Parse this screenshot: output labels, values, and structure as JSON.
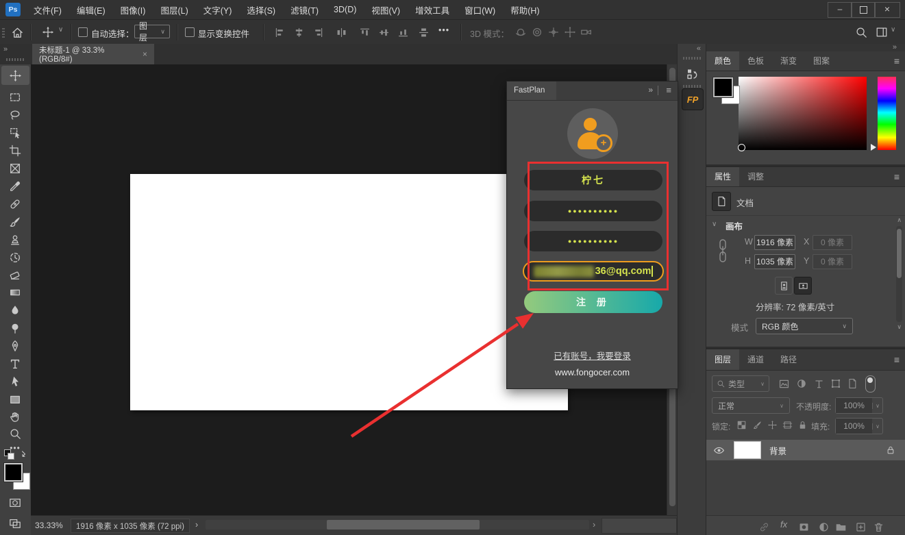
{
  "colors": {
    "accent_orange": "#f09d1f",
    "form_text_green": "#d6e44e",
    "register_gradient_start": "#94ca7d",
    "register_gradient_end": "#17a9aa",
    "annotation_red": "#e93030"
  },
  "icons": {
    "app_logo": "Ps",
    "collapse_right": "»",
    "collapse_left": "«",
    "panel_menu": "≡",
    "close": "×",
    "chevron_down": "∨",
    "chevron_up": "∧",
    "chevron_right": "›",
    "chevron_left": "‹",
    "ellipsis": "•••",
    "fx": "fx",
    "fp_badge": "FP",
    "minimize": "–"
  },
  "menu": {
    "items": [
      "文件(F)",
      "编辑(E)",
      "图像(I)",
      "图层(L)",
      "文字(Y)",
      "选择(S)",
      "滤镜(T)",
      "3D(D)",
      "视图(V)",
      "增效工具",
      "窗口(W)",
      "帮助(H)"
    ]
  },
  "options_bar": {
    "auto_select_label": "自动选择：",
    "auto_select_value": "图层",
    "show_transform_label": "显示变换控件",
    "mode_3d_label": "3D 模式："
  },
  "document": {
    "tab_title": "未标题-1 @ 33.3%(RGB/8#)"
  },
  "toolbar": {
    "tools": [
      "move",
      "rectangular-marquee",
      "lasso",
      "object-selection",
      "crop",
      "frame",
      "eyedropper",
      "spot-healing-brush",
      "brush",
      "clone-stamp",
      "history-brush",
      "eraser",
      "gradient",
      "blur",
      "dodge",
      "pen",
      "type",
      "path-selection",
      "rectangle",
      "hand",
      "zoom",
      "edit-toolbar"
    ]
  },
  "fastplan": {
    "tab_title": "FastPlan",
    "username": "柠七",
    "password_mask": "●●●●●●●●●●",
    "confirm_password_mask": "●●●●●●●●●●",
    "email_visible": "36@qq.com",
    "register_label": "注 册",
    "login_link": "已有账号，我要登录",
    "website": "www.fongocer.com"
  },
  "color_panel": {
    "tabs": [
      "颜色",
      "色板",
      "渐变",
      "图案"
    ]
  },
  "properties_panel": {
    "tabs": [
      "属性",
      "调整"
    ],
    "document_label": "文档",
    "section_canvas": "画布",
    "w_label": "W",
    "w_value": "1916 像素",
    "x_label": "X",
    "x_value": "0 像素",
    "h_label": "H",
    "h_value": "1035 像素",
    "y_label": "Y",
    "y_value": "0 像素",
    "resolution_text": "分辨率: 72 像素/英寸",
    "mode_label": "模式",
    "mode_value": "RGB 颜色"
  },
  "layers_panel": {
    "tabs": [
      "图层",
      "通道",
      "路径"
    ],
    "filter_label": "类型",
    "blend_mode": "正常",
    "opacity_label": "不透明度:",
    "opacity_value": "100%",
    "lock_label": "锁定:",
    "fill_label": "填充:",
    "fill_value": "100%",
    "layers": [
      {
        "name": "背景",
        "locked": true,
        "visible": true
      }
    ]
  },
  "status_bar": {
    "zoom_value": "33.33%",
    "doc_dimensions": "1916 像素 x 1035 像素 (72 ppi)"
  }
}
